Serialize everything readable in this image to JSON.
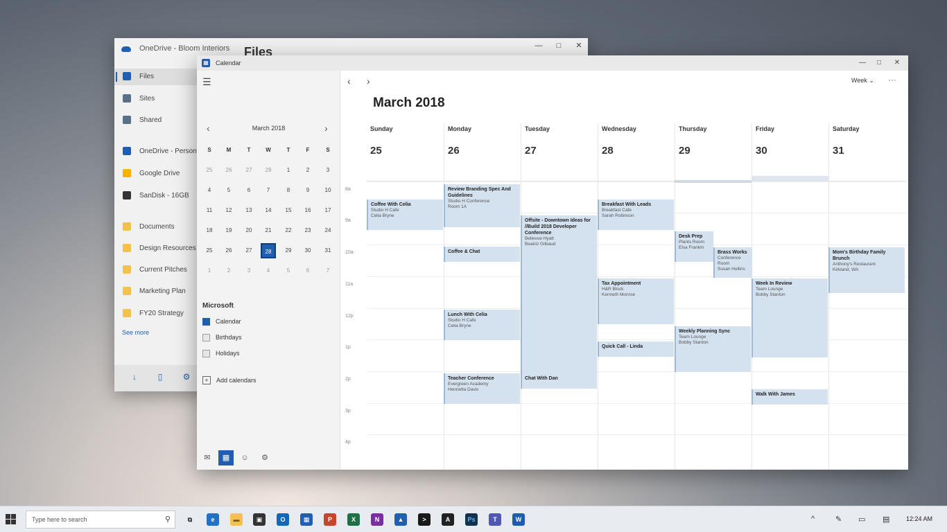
{
  "files_window": {
    "app_title": "OneDrive - Bloom Interiors",
    "heading": "Files",
    "controls": [
      "—",
      "□",
      "✕"
    ],
    "nav": [
      {
        "label": "Files",
        "icon": "folder-icon",
        "color": "#1f5fae"
      },
      {
        "label": "Sites",
        "icon": "sites-icon",
        "color": "#5a6f8a"
      },
      {
        "label": "Shared",
        "icon": "shared-icon",
        "color": "#5a6f8a"
      },
      {
        "label": "OneDrive - Personal",
        "icon": "cloud-icon",
        "color": "#1f5fae"
      },
      {
        "label": "Google Drive",
        "icon": "google-drive-icon",
        "color": "#f4b400"
      },
      {
        "label": "SanDisk - 16GB",
        "icon": "usb-drive-icon",
        "color": "#333333"
      },
      {
        "label": "Documents",
        "icon": "folder-icon",
        "color": "#f3c14f"
      },
      {
        "label": "Design Resources",
        "icon": "folder-icon",
        "color": "#f3c14f"
      },
      {
        "label": "Current Pitches",
        "icon": "folder-icon",
        "color": "#f3c14f"
      },
      {
        "label": "Marketing Plan",
        "icon": "folder-icon",
        "color": "#f3c14f"
      },
      {
        "label": "FY20 Strategy",
        "icon": "folder-icon",
        "color": "#f3c14f"
      }
    ],
    "see_more": "See more",
    "bottom_icons": [
      "↓",
      "▯",
      "⚙"
    ]
  },
  "calendar_window": {
    "app_title": "Calendar",
    "controls": [
      "—",
      "□",
      "✕"
    ],
    "mini_calendar": {
      "title": "March 2018",
      "weekdays": [
        "S",
        "M",
        "T",
        "W",
        "T",
        "F",
        "S"
      ],
      "weeks": [
        [
          "25",
          "26",
          "27",
          "28",
          "1",
          "2",
          "3"
        ],
        [
          "4",
          "5",
          "6",
          "7",
          "8",
          "9",
          "10"
        ],
        [
          "11",
          "12",
          "13",
          "14",
          "15",
          "16",
          "17"
        ],
        [
          "18",
          "19",
          "20",
          "21",
          "22",
          "23",
          "24"
        ],
        [
          "25",
          "26",
          "27",
          "28",
          "29",
          "30",
          "31"
        ],
        [
          "1",
          "2",
          "3",
          "4",
          "5",
          "6",
          "7"
        ]
      ],
      "selected": "28"
    },
    "account": "Microsoft",
    "calendars": [
      {
        "label": "Calendar",
        "checked": true
      },
      {
        "label": "Birthdays",
        "checked": false
      },
      {
        "label": "Holidays",
        "checked": false
      }
    ],
    "add_calendars": "Add calendars",
    "view": "Week",
    "month_title": "March 2018",
    "days": [
      {
        "name": "Sunday",
        "num": "25"
      },
      {
        "name": "Monday",
        "num": "26"
      },
      {
        "name": "Tuesday",
        "num": "27"
      },
      {
        "name": "Wednesday",
        "num": "28"
      },
      {
        "name": "Thursday",
        "num": "29"
      },
      {
        "name": "Friday",
        "num": "30"
      },
      {
        "name": "Saturday",
        "num": "31"
      }
    ],
    "times": [
      "8a",
      "9a",
      "10a",
      "11a",
      "12p",
      "1p",
      "2p",
      "3p",
      "4p"
    ],
    "events": [
      {
        "title": "Coffee With Celia",
        "sub": [
          "Studio H Cafe",
          "Celia Bryne"
        ]
      },
      {
        "title": "Review Branding Spec And Guidelines",
        "sub": [
          "Studio H Conference",
          "Room 1A"
        ]
      },
      {
        "title": "Coffee & Chat",
        "sub": []
      },
      {
        "title": "Lunch With Celia",
        "sub": [
          "Studio H Cafe",
          "Celia Bryne"
        ]
      },
      {
        "title": "Teacher Conference",
        "sub": [
          "Evergreen Academy",
          "Henrietta Davis"
        ]
      },
      {
        "title": "Offsite - Downtown Ideas for //Build 2018 Developer Conference",
        "sub": [
          "Bellevue Hyatt",
          "Beatriz Gilbaud"
        ]
      },
      {
        "title": "Chat With Dan",
        "sub": []
      },
      {
        "title": "Breakfast With Leads",
        "sub": [
          "Breakfast Cafe",
          "Sarah Robinson"
        ]
      },
      {
        "title": "Tax Appointment",
        "sub": [
          "H&R Block",
          "Kenneth Monroe"
        ]
      },
      {
        "title": "Quick Call - Linda",
        "sub": []
      },
      {
        "title": "Desk Prep",
        "sub": [
          "Plants Room",
          "Elsa Frankin"
        ]
      },
      {
        "title": "Weekly Planning Sync",
        "sub": [
          "Team Lounge",
          "Bobby Stanton"
        ]
      },
      {
        "title": "Brass Works",
        "sub": [
          "Conference Room",
          "Susan Hollins"
        ]
      },
      {
        "title": "Week In Review",
        "sub": [
          "Team Lounge",
          "Bobby Stanton"
        ]
      },
      {
        "title": "Walk With James",
        "sub": []
      },
      {
        "title": "Mom's Birthday Family Brunch",
        "sub": [
          "Anthony's Restaurant",
          "Kirkland, WA"
        ]
      }
    ]
  },
  "taskbar": {
    "search_placeholder": "Type here to search",
    "apps": [
      {
        "name": "task-view-icon",
        "glyph": "⧉",
        "color": "#e8ebef",
        "fg": "#333333"
      },
      {
        "name": "edge-icon",
        "glyph": "e",
        "color": "#1e73c8",
        "fg": "#ffffff"
      },
      {
        "name": "file-explorer-icon",
        "glyph": "▬",
        "color": "#f3c14f",
        "fg": "#7a5b10"
      },
      {
        "name": "store-icon",
        "glyph": "▣",
        "color": "#333333",
        "fg": "#ffffff"
      },
      {
        "name": "outlook-icon",
        "glyph": "O",
        "color": "#1167b8",
        "fg": "#ffffff"
      },
      {
        "name": "calendar-icon",
        "glyph": "▦",
        "color": "#1f5fae",
        "fg": "#ffffff"
      },
      {
        "name": "powerpoint-icon",
        "glyph": "P",
        "color": "#c8442a",
        "fg": "#ffffff"
      },
      {
        "name": "excel-icon",
        "glyph": "X",
        "color": "#1e7145",
        "fg": "#ffffff"
      },
      {
        "name": "onenote-icon",
        "glyph": "N",
        "color": "#7b2f9e",
        "fg": "#ffffff"
      },
      {
        "name": "photos-icon",
        "glyph": "▲",
        "color": "#1f5fae",
        "fg": "#ffffff"
      },
      {
        "name": "terminal-icon",
        "glyph": ">",
        "color": "#1a1a1a",
        "fg": "#ffffff"
      },
      {
        "name": "adobe-icon",
        "glyph": "A",
        "color": "#222222",
        "fg": "#ffffff"
      },
      {
        "name": "photoshop-icon",
        "glyph": "Ps",
        "color": "#12324e",
        "fg": "#5bb5f5"
      },
      {
        "name": "teams-icon",
        "glyph": "T",
        "color": "#5057b0",
        "fg": "#ffffff"
      },
      {
        "name": "word-icon",
        "glyph": "W",
        "color": "#1d5bb5",
        "fg": "#ffffff"
      }
    ],
    "clock": "12:24 AM"
  }
}
